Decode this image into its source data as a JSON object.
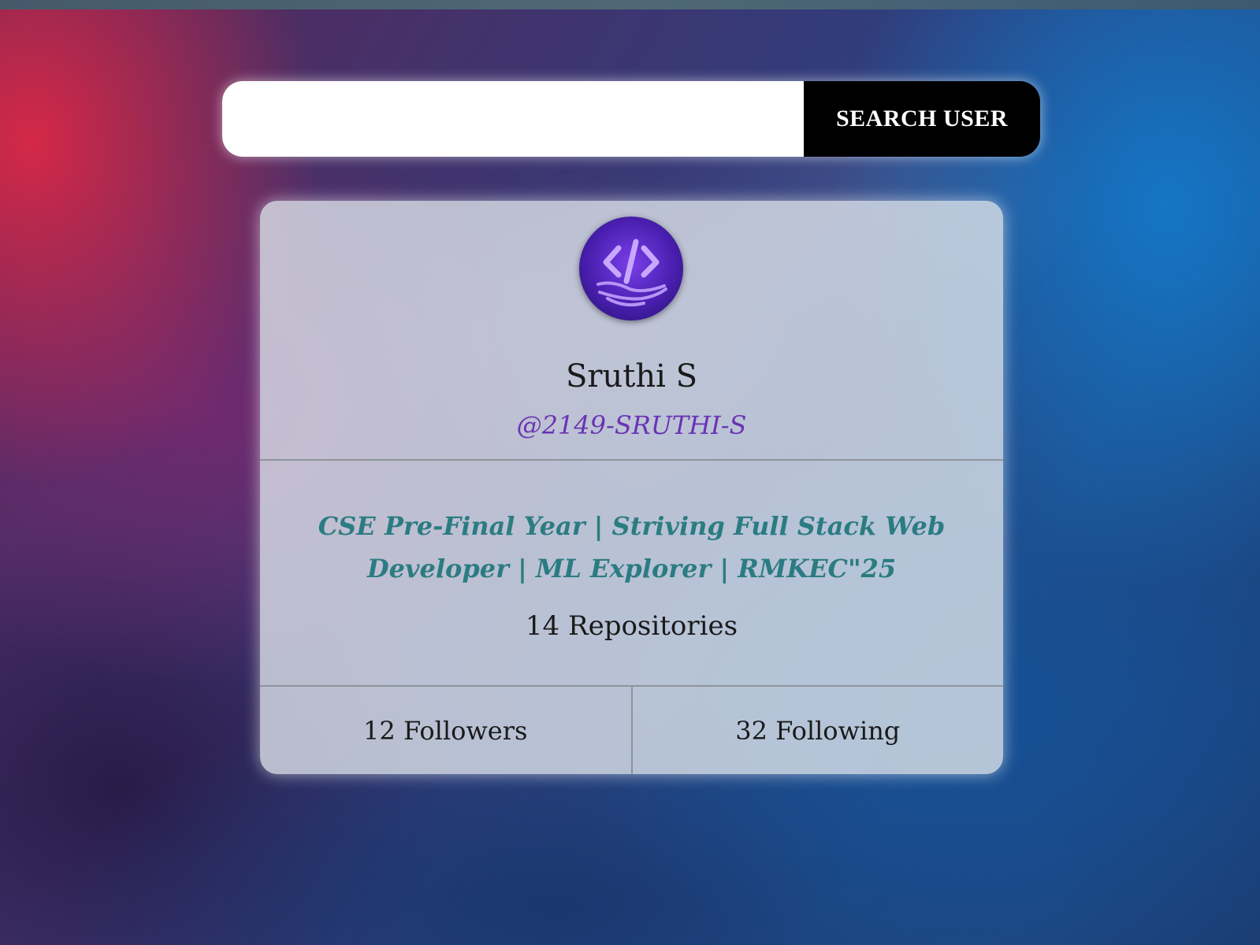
{
  "search": {
    "value": "",
    "button_label": "SEARCH USER"
  },
  "profile": {
    "avatar_icon": "code-hand-icon",
    "name": "Sruthi S",
    "login": "@2149-SRUTHI-S",
    "bio": "CSE Pre-Final Year | Striving Full Stack Web Developer | ML Explorer | RMKEC\"25",
    "repositories": "14 Repositories",
    "followers": "12 Followers",
    "following": "32 Following"
  },
  "colors": {
    "login": "#6a33b5",
    "bio": "#2b7c82",
    "button_bg": "#000000"
  }
}
